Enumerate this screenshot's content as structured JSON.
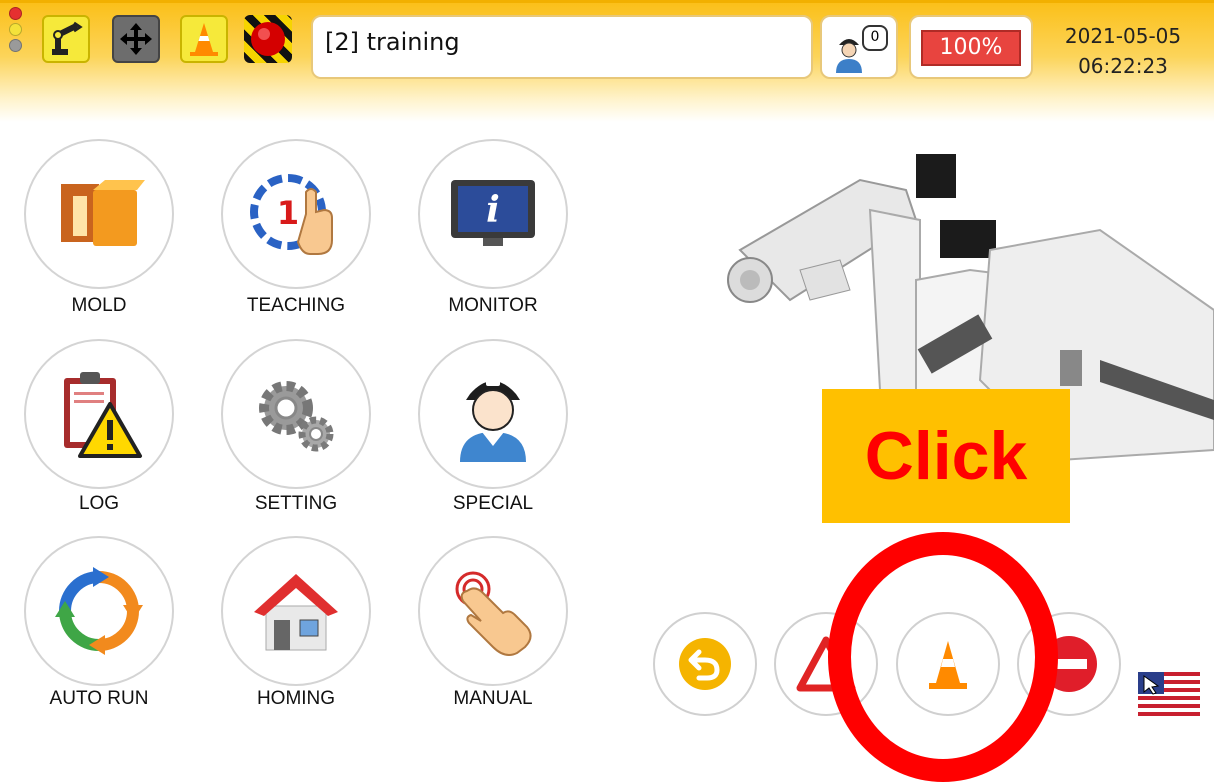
{
  "topbar": {
    "program_name": "[2] training",
    "operator_count": "0",
    "speed": "100%",
    "date": "2021-05-05",
    "time": "06:22:23",
    "status_lights": [
      "#e53030",
      "#f4e23a",
      "#9a9a9a"
    ],
    "icons": [
      "robot-arm-icon",
      "move-arrows-icon",
      "traffic-cone-icon",
      "emergency-stop-icon"
    ]
  },
  "menu": {
    "items": [
      {
        "label": "MOLD",
        "icon": "mold-icon"
      },
      {
        "label": "TEACHING",
        "icon": "teaching-icon"
      },
      {
        "label": "MONITOR",
        "icon": "monitor-icon"
      },
      {
        "label": "LOG",
        "icon": "log-icon"
      },
      {
        "label": "SETTING",
        "icon": "setting-gears-icon"
      },
      {
        "label": "SPECIAL",
        "icon": "special-worker-icon"
      },
      {
        "label": "AUTO RUN",
        "icon": "auto-run-cycle-icon"
      },
      {
        "label": "HOMING",
        "icon": "homing-house-icon"
      },
      {
        "label": "MANUAL",
        "icon": "manual-hand-icon"
      }
    ]
  },
  "bottom_buttons": [
    "return-icon",
    "warning-triangle-icon",
    "traffic-cone-icon",
    "stop-icon"
  ],
  "language_icon": "us-flag-icon",
  "annotation": {
    "label": "Click",
    "colors": {
      "box": "#ffc000",
      "text": "#ff0000",
      "ring": "#ff0000"
    }
  }
}
